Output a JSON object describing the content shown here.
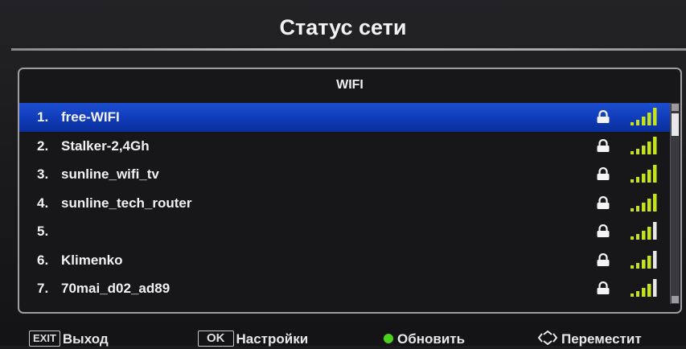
{
  "title": "Статус сети",
  "panel": {
    "header": "WIFI"
  },
  "networks": [
    {
      "num": "1.",
      "ssid": "free-WIFI",
      "locked": true,
      "signal_bars": 5,
      "selected": true
    },
    {
      "num": "2.",
      "ssid": "Stalker-2,4Gh",
      "locked": true,
      "signal_bars": 5,
      "selected": false
    },
    {
      "num": "3.",
      "ssid": "sunline_wifi_tv",
      "locked": true,
      "signal_bars": 5,
      "selected": false
    },
    {
      "num": "4.",
      "ssid": "sunline_tech_router",
      "locked": true,
      "signal_bars": 5,
      "selected": false
    },
    {
      "num": "5.",
      "ssid": "",
      "locked": true,
      "signal_bars": 4,
      "selected": false
    },
    {
      "num": "6.",
      "ssid": "Klimenko",
      "locked": true,
      "signal_bars": 4,
      "selected": false
    },
    {
      "num": "7.",
      "ssid": "70mai_d02_ad89",
      "locked": true,
      "signal_bars": 4,
      "selected": false
    }
  ],
  "footer": {
    "exit_key": "EXIT",
    "exit_label": "Выход",
    "ok_key": "OK",
    "ok_label": "Настройки",
    "refresh_label": "Обновить",
    "move_label": "Переместит"
  },
  "colors": {
    "selection": "#1d4fd0",
    "signal_active": "#c6e21c",
    "signal_inactive": "#e8e8e8",
    "refresh_dot": "#4cd21e"
  },
  "icons": {
    "lock": "lock-icon",
    "signal": "wifi-signal-icon",
    "refresh": "green-button-icon",
    "move": "navigation-arrows-icon"
  }
}
